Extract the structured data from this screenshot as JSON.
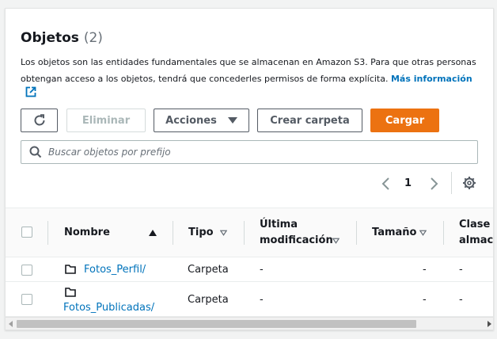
{
  "header": {
    "title": "Objetos",
    "count": "(2)",
    "description": "Los objetos son las entidades fundamentales que se almacenan en Amazon S3. Para que otras personas obtengan acceso a los objetos, tendrá que concederles permisos de forma explícita. ",
    "more_info": "Más información"
  },
  "toolbar": {
    "delete_label": "Eliminar",
    "actions_label": "Acciones",
    "create_folder_label": "Crear carpeta",
    "upload_label": "Cargar"
  },
  "search": {
    "placeholder": "Buscar objetos por prefijo"
  },
  "pagination": {
    "current_page": "1"
  },
  "table": {
    "columns": {
      "name": "Nombre",
      "type": "Tipo",
      "last_modified_line1": "Última",
      "last_modified_line2": "modificación",
      "size": "Tamaño",
      "class_line1": "Clase d",
      "class_line2": "almace"
    },
    "rows": [
      {
        "name": "Fotos_Perfil/",
        "type": "Carpeta",
        "last_modified": "-",
        "size": "-",
        "class": "-"
      },
      {
        "name": "Fotos_Publicadas/",
        "type": "Carpeta",
        "last_modified": "-",
        "size": "-",
        "class": "-"
      }
    ]
  },
  "colors": {
    "accent": "#ec7211",
    "link": "#0073bb",
    "text": "#16191f",
    "muted": "#687078"
  }
}
